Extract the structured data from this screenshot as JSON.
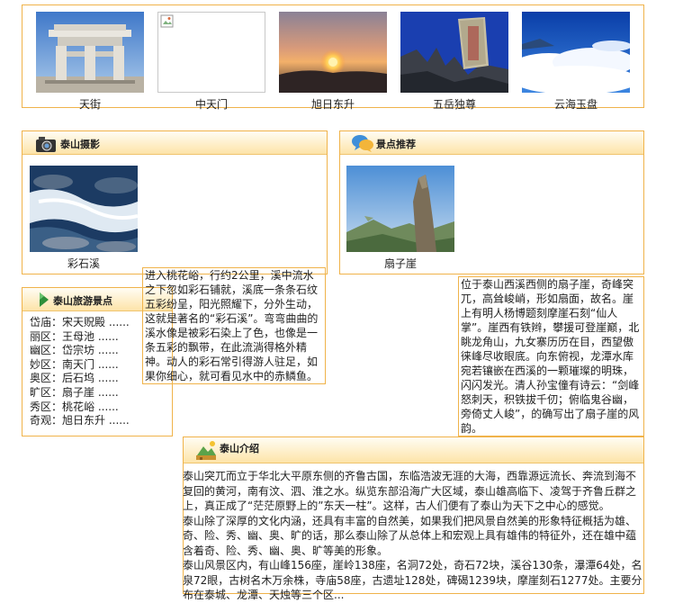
{
  "gallery": [
    {
      "caption": "天街",
      "icon": "memorial-archway-photo"
    },
    {
      "caption": "中天门",
      "icon": "broken-image-icon"
    },
    {
      "caption": "旭日东升",
      "icon": "sunrise-photo"
    },
    {
      "caption": "五岳独尊",
      "icon": "inscribed-rock-photo"
    },
    {
      "caption": "云海玉盘",
      "icon": "sea-of-clouds-photo"
    }
  ],
  "photo_panel": {
    "title": "泰山摄影",
    "icon": "camera-icon",
    "caption": "彩石溪",
    "text": "进入桃花峪，行约2公里，溪中流水之下忽如彩石铺就，溪底一条条石纹五彩纷呈，阳光照耀下，分外生动，这就是著名的“彩石溪”。弯弯曲曲的溪水像是被彩石染上了色，也像是一条五彩的飘带，在此流淌得格外精神。动人的彩石常引得游人驻足，如果你细心，就可看见水中的赤鳞鱼。"
  },
  "recommend_panel": {
    "title": "景点推荐",
    "icon": "chat-bubbles-icon",
    "caption": "扇子崖",
    "text": "位于泰山西溪西侧的扇子崖，奇峰突兀，高耸峻峭，形如扇面，故名。崖上有明人杨博题刻摩崖石刻“仙人掌”。崖西有铁辫，攀援可登崖巅，北眺龙角山，九女寨历历在目，西望傲徕峰尽收眼底。向东俯视，龙潭水库宛若镶嵌在西溪的一颗璀璨的明珠，闪闪发光。清人孙宝僮有诗云：“剑峰怒刺天，积铁拔千仞；俯临鬼谷幽，旁倚丈人峻”，的确写出了扇子崖的风韵。"
  },
  "scenic_list": {
    "title": "泰山旅游景点",
    "icon": "location-pin-icon",
    "items": [
      "岱庙：宋天贶殿 ......",
      "丽区：王母池 ......",
      "幽区：岱宗坊 ......",
      "妙区：南天门 ......",
      "奥区：后石坞 ......",
      "旷区：扇子崖 ......",
      "秀区：桃花峪 ......",
      "奇观：旭日东升 ......"
    ]
  },
  "intro": {
    "title": "泰山介绍",
    "icon": "mountain-icon",
    "paragraphs": [
      "泰山突兀而立于华北大平原东侧的齐鲁古国，东临浩波无涯的大海，西靠源远流长、奔流到海不复回的黄河，南有汶、泗、淮之水。纵览东部沿海广大区域，泰山雄高临下、凌驾于齐鲁丘群之上，真正成了“茫茫原野上的”东天一柱”。这样，古人们便有了泰山为天下之中心的感觉。",
      "泰山除了深厚的文化内涵，还具有丰富的自然美，如果我们把风景自然美的形象特征概括为雄、奇、险、秀、幽、奥、旷的话，那么泰山除了从总体上和宏观上具有雄伟的特征外，还在雄中蕴含着奇、险、秀、幽、奥、旷等美的形象。",
      "泰山风景区内，有山峰156座，崖岭138座，名洞72处，奇石72块，溪谷130条，瀑潭64处，名泉72眼，古树名木万余株，寺庙58座，古遗址128处，碑碣1239块，摩崖刻石1277处。主要分布在泰城、龙潭、天烛等三个区..."
    ]
  },
  "colors": {
    "border": "#f0b34a",
    "header_bg": "#fde4a8"
  }
}
